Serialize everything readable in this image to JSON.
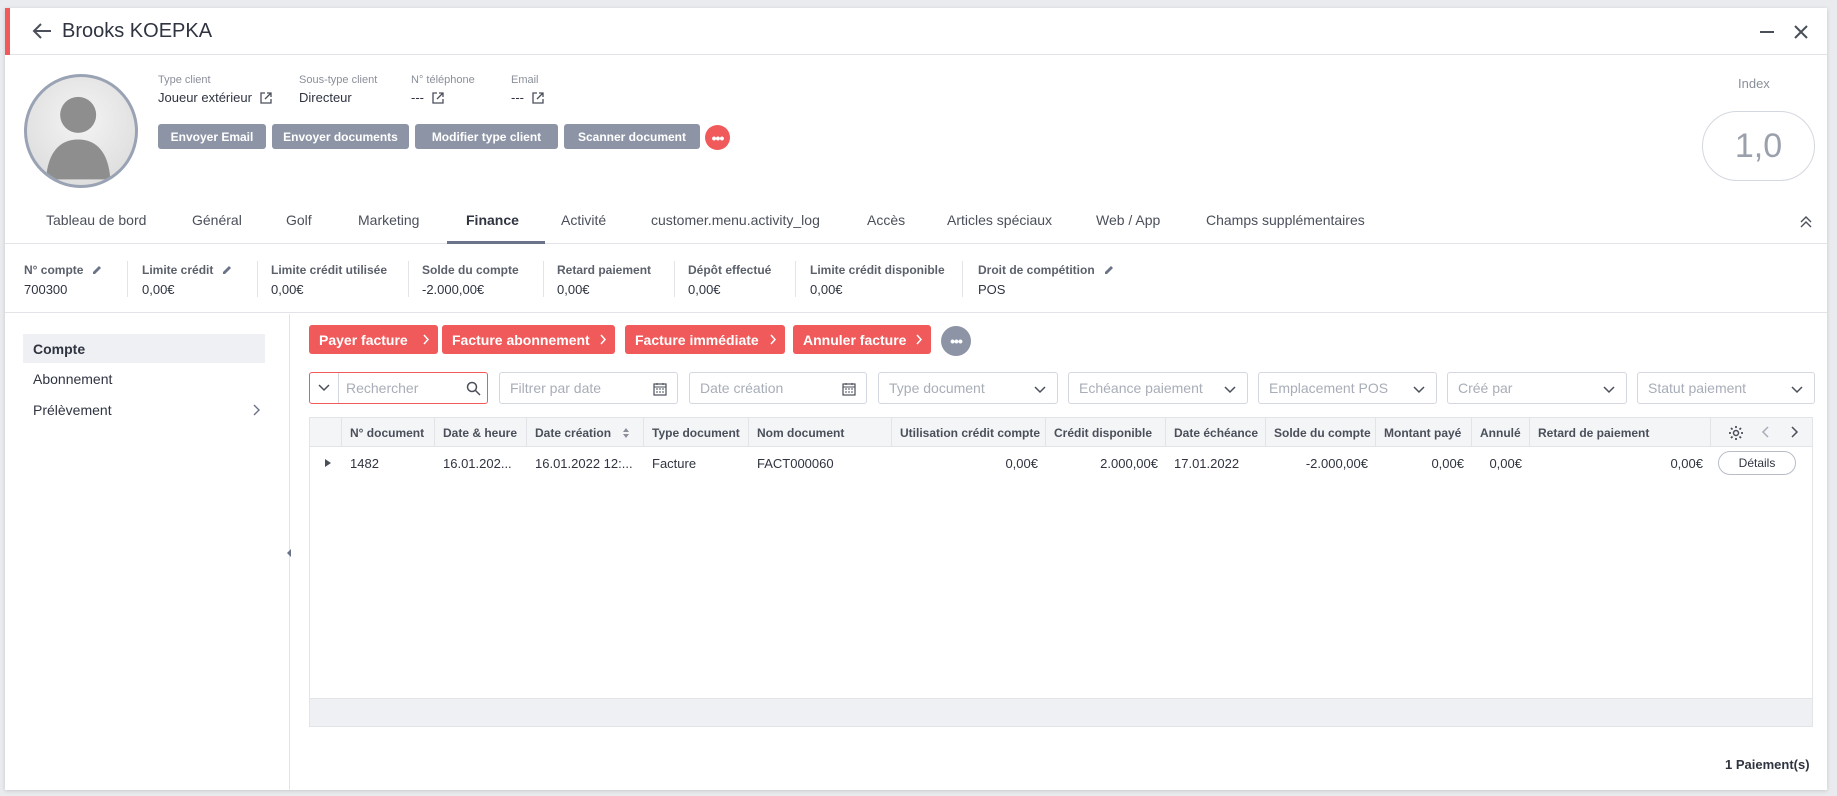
{
  "window": {
    "title": "Brooks KOEPKA"
  },
  "profile": {
    "fields": [
      {
        "label": "Type client",
        "value": "Joueur extérieur"
      },
      {
        "label": "Sous-type client",
        "value": "Directeur"
      },
      {
        "label": "N° téléphone",
        "value": "---"
      },
      {
        "label": "Email",
        "value": "---"
      }
    ],
    "actions": [
      "Envoyer Email",
      "Envoyer documents",
      "Modifier type client",
      "Scanner document"
    ],
    "index_label": "Index",
    "index_value": "1,0"
  },
  "tabs": [
    "Tableau de bord",
    "Général",
    "Golf",
    "Marketing",
    "Finance",
    "Activité",
    "customer.menu.activity_log",
    "Accès",
    "Articles spéciaux",
    "Web / App",
    "Champs supplémentaires"
  ],
  "active_tab": "Finance",
  "stats": [
    {
      "label": "N° compte",
      "value": "700300"
    },
    {
      "label": "Limite crédit",
      "value": "0,00€"
    },
    {
      "label": "Limite crédit utilisée",
      "value": "0,00€"
    },
    {
      "label": "Solde du compte",
      "value": "-2.000,00€"
    },
    {
      "label": "Retard paiement",
      "value": "0,00€"
    },
    {
      "label": "Dépôt effectué",
      "value": "0,00€"
    },
    {
      "label": "Limite crédit disponible",
      "value": "0,00€"
    },
    {
      "label": "Droit de compétition",
      "value": "POS"
    }
  ],
  "sidebar": {
    "items": [
      "Compte",
      "Abonnement",
      "Prélèvement"
    ]
  },
  "finance_actions": [
    "Payer facture",
    "Facture abonnement",
    "Facture immédiate",
    "Annuler facture"
  ],
  "filters": {
    "search_placeholder": "Rechercher",
    "date_filter": "Filtrer par date",
    "date_creation": "Date création",
    "type_document": "Type document",
    "echeance": "Echéance paiement",
    "emplacement": "Emplacement POS",
    "cree_par": "Créé par",
    "statut": "Statut paiement"
  },
  "table": {
    "columns": [
      "N° document",
      "Date & heure",
      "Date création",
      "Type document",
      "Nom document",
      "Utilisation crédit compte",
      "Crédit disponible",
      "Date échéance",
      "Solde du compte",
      "Montant payé",
      "Annulé",
      "Retard de paiement"
    ],
    "rows": [
      {
        "no_document": "1482",
        "date_heure": "16.01.202...",
        "date_creation": "16.01.2022 12:...",
        "type_document": "Facture",
        "nom_document": "FACT000060",
        "utilisation_credit": "0,00€",
        "credit_disponible": "2.000,00€",
        "date_echeance": "17.01.2022",
        "solde_compte": "-2.000,00€",
        "montant_paye": "0,00€",
        "annule": "0,00€",
        "retard_paiement": "0,00€",
        "details_label": "Détails"
      }
    ]
  },
  "footer": {
    "count": "1 Paiement(s)"
  },
  "colors": {
    "accent_red": "#f05a5a",
    "action_grey": "#8d94a6",
    "underline": "#6b7388"
  }
}
